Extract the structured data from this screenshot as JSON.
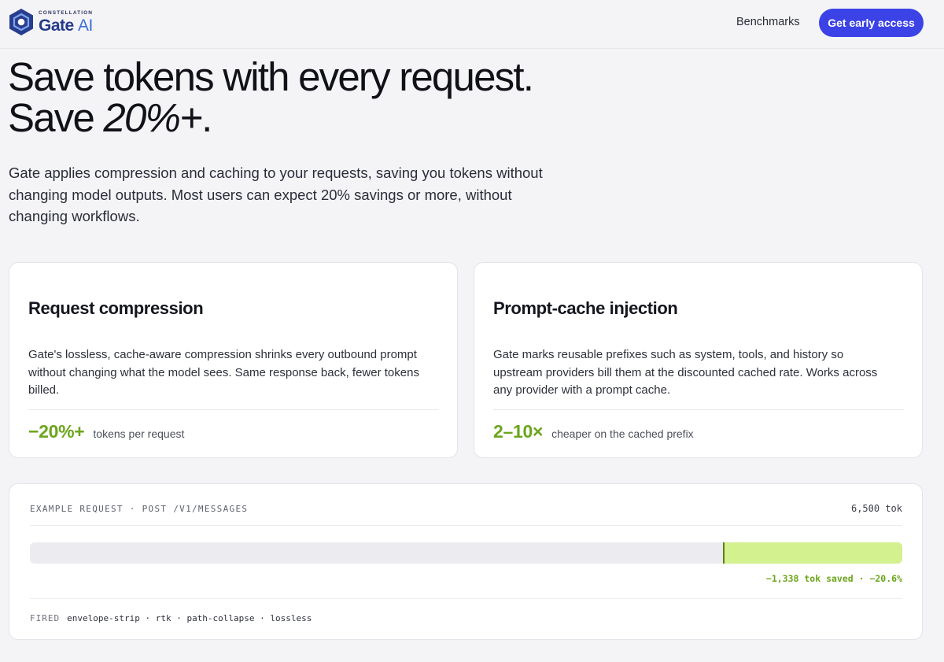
{
  "header": {
    "logo_sub": "CONSTELLATION",
    "logo_name": "Gate",
    "logo_name_ai": "AI",
    "nav_benchmarks": "Benchmarks",
    "cta_label": "Get early access"
  },
  "hero": {
    "title_line1": "Save tokens with every request.",
    "title_line2_prefix": "Save ",
    "title_line2_emph": "20%+",
    "title_line2_suffix": ".",
    "description": "Gate applies compression and caching to your requests, saving you tokens without changing model outputs. Most users can expect 20% savings or more, without changing workflows."
  },
  "cards": [
    {
      "title": "Request compression",
      "body": "Gate's lossless, cache-aware compression shrinks every outbound prompt without changing what the model sees. Same response back, fewer tokens billed.",
      "stat_value": "−20%+",
      "stat_label": "tokens per request"
    },
    {
      "title": "Prompt-cache injection",
      "body": "Gate marks reusable prefixes such as system, tools, and history so upstream providers bill them at the discounted cached rate. Works across any provider with a prompt cache.",
      "stat_value": "2–10×",
      "stat_label": "cheaper on the cached prefix"
    }
  ],
  "example": {
    "title": "EXAMPLE REQUEST · POST /V1/MESSAGES",
    "total": "6,500 tok",
    "saved_fraction": 0.206,
    "saved_note": "−1,338 tok saved · −20.6%",
    "fired_label": "FIRED",
    "fired_items": "envelope-strip · rtk · path-collapse · lossless"
  },
  "colors": {
    "accent": "#3c43e6",
    "savings_green": "#6ba51c",
    "saved_bar": "#d3f18e"
  }
}
